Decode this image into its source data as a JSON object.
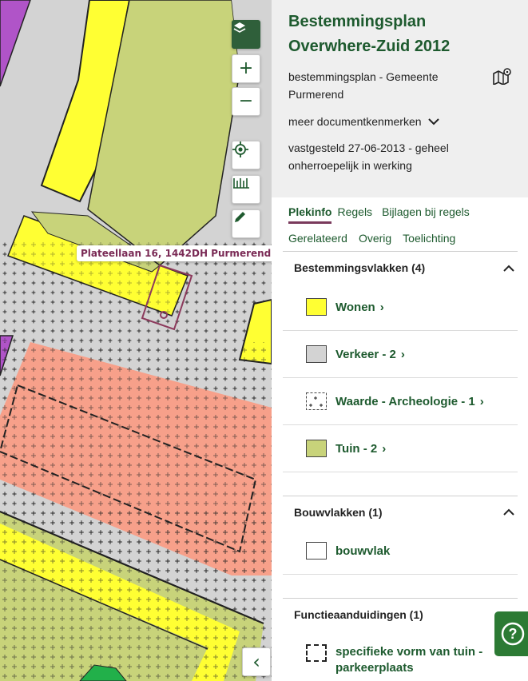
{
  "map": {
    "address_label": "Plateellaan 16, 1442DH Purmerend",
    "colors": {
      "wonen": "#ffff33",
      "verkeer": "#d3d3d3",
      "tuin": "#c8d37a",
      "maatschappelijk": "#f7a08a",
      "purple": "#b054c8",
      "green": "#22b04a",
      "outline": "#8c3a5c"
    },
    "buttons": {
      "layers_icon": "layers-icon",
      "zoom_in": "+",
      "zoom_out": "−",
      "locate_icon": "crosshair-icon",
      "measure_icon": "ruler-icon",
      "draw_icon": "pencil-icon",
      "collapse": "‹"
    }
  },
  "header": {
    "title": "Bestemmingsplan Overwhere-Zuid 2012",
    "subtitle": "bestemmingsplan - Gemeente Purmerend",
    "meer": "meer documentkenmerken",
    "status": "vastgesteld 27-06-2013 - geheel onherroepelijk in werking"
  },
  "tabs": {
    "row1": [
      "Plekinfo",
      "Regels",
      "Bijlagen bij regels"
    ],
    "row2": [
      "Gerelateerd",
      "Overig",
      "Toelichting"
    ],
    "active": "Plekinfo"
  },
  "sections": [
    {
      "title": "Bestemmingsvlakken (4)",
      "items": [
        {
          "label": "Wonen",
          "swatch": "#ffff33",
          "pattern": "none"
        },
        {
          "label": "Verkeer - 2",
          "swatch": "#d3d3d3",
          "pattern": "none"
        },
        {
          "label": "Waarde - Archeologie - 1",
          "swatch": "#ffffff",
          "pattern": "plus"
        },
        {
          "label": "Tuin - 2",
          "swatch": "#c8d37a",
          "pattern": "none"
        }
      ]
    },
    {
      "title": "Bouwvlakken (1)",
      "items": [
        {
          "label": "bouwvlak",
          "swatch": "#ffffff",
          "pattern": "none"
        }
      ]
    },
    {
      "title": "Functieaanduidingen (1)",
      "items": [
        {
          "label": "specifieke vorm van tuin - parkeerplaats",
          "swatch": "#ffffff",
          "pattern": "dashed"
        }
      ]
    }
  ],
  "help": {
    "label": "?"
  }
}
